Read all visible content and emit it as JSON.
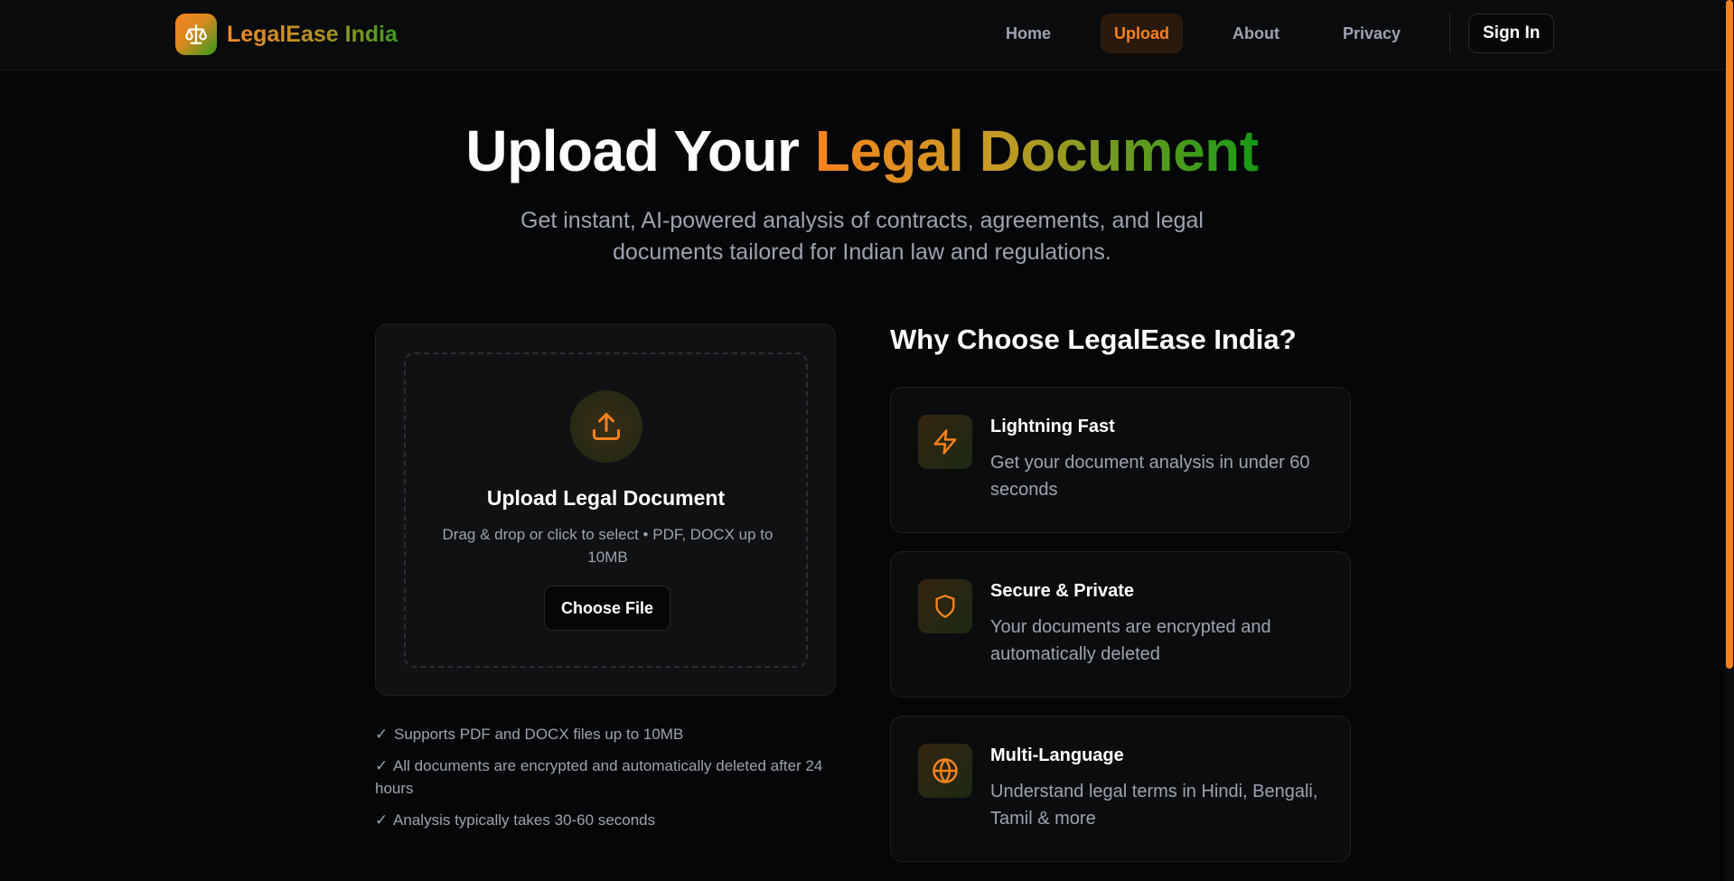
{
  "header": {
    "brand": "LegalEase India",
    "nav": [
      {
        "label": "Home",
        "active": false
      },
      {
        "label": "Upload",
        "active": true
      },
      {
        "label": "About",
        "active": false
      },
      {
        "label": "Privacy",
        "active": false
      }
    ],
    "signin_label": "Sign In"
  },
  "hero": {
    "title_plain": "Upload Your ",
    "title_highlight": "Legal Document",
    "subtitle": "Get instant, AI-powered analysis of contracts, agreements, and legal documents tailored for Indian law and regulations."
  },
  "upload": {
    "icon": "upload-icon",
    "title": "Upload Legal Document",
    "description": "Drag & drop or click to select • PDF, DOCX up to 10MB",
    "button_label": "Choose File"
  },
  "checks": [
    "Supports PDF and DOCX files up to 10MB",
    "All documents are encrypted and automatically deleted after 24 hours",
    "Analysis typically takes 30-60 seconds"
  ],
  "why": {
    "title": "Why Choose LegalEase India?",
    "features": [
      {
        "icon": "lightning-icon",
        "title": "Lightning Fast",
        "description": "Get your document analysis in under 60 seconds"
      },
      {
        "icon": "shield-icon",
        "title": "Secure & Private",
        "description": "Your documents are encrypted and automatically deleted"
      },
      {
        "icon": "globe-icon",
        "title": "Multi-Language",
        "description": "Understand legal terms in Hindi, Bengali, Tamil & more"
      }
    ]
  },
  "colors": {
    "accent": "#f5821f",
    "green": "#159a14",
    "background": "#050607"
  }
}
